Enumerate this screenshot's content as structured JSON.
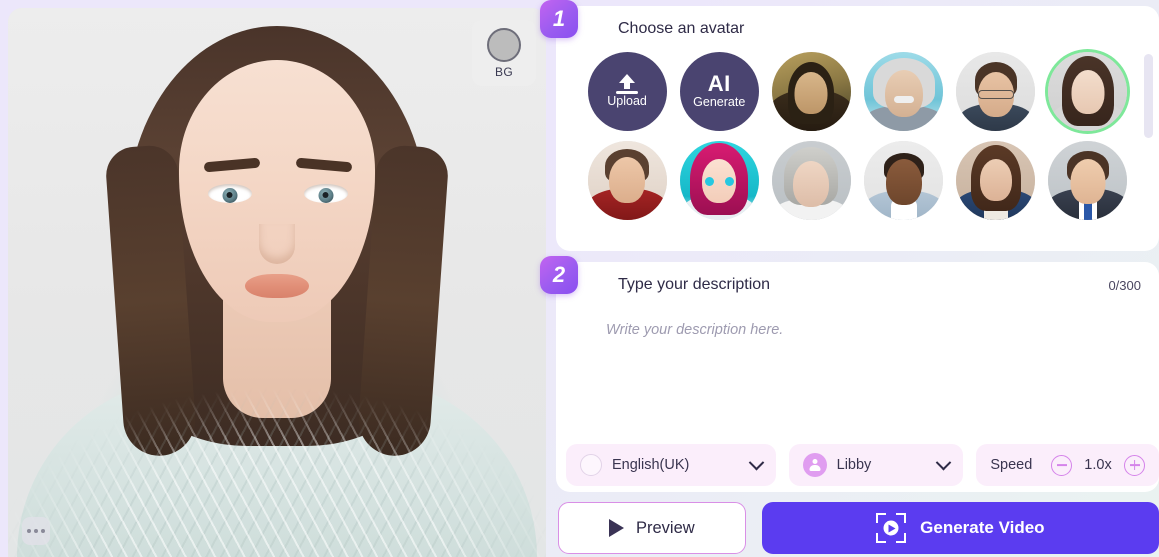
{
  "preview": {
    "bg_button": {
      "label": "BG",
      "icon": "background-circle-icon"
    },
    "menu_button": {
      "icon": "ellipsis-icon"
    }
  },
  "step1": {
    "badge": "1",
    "title": "Choose an avatar",
    "actions": [
      {
        "name": "upload",
        "glyph": "upload-arrow-icon",
        "label": "Upload"
      },
      {
        "name": "ai-generate",
        "glyph": "AI",
        "label": "Generate"
      }
    ],
    "avatars": [
      {
        "id": "mona-lisa",
        "selected": false
      },
      {
        "id": "einstein",
        "selected": false
      },
      {
        "id": "man-glasses",
        "selected": false
      },
      {
        "id": "woman-dark-hair",
        "selected": true
      },
      {
        "id": "man-red-jacket",
        "selected": false
      },
      {
        "id": "anime-pink-hair",
        "selected": false
      },
      {
        "id": "senior-woman",
        "selected": false
      },
      {
        "id": "man-blue-shirt",
        "selected": false
      },
      {
        "id": "woman-blazer",
        "selected": false
      },
      {
        "id": "man-suit-tie",
        "selected": false
      }
    ]
  },
  "step2": {
    "badge": "2",
    "title": "Type your description",
    "char_count": "0/300",
    "textarea_value": "",
    "textarea_placeholder": "Write your description here."
  },
  "controls": {
    "language": {
      "value": "English(UK)",
      "icon": "flag-placeholder-icon"
    },
    "voice": {
      "value": "Libby",
      "icon": "person-icon"
    },
    "speed": {
      "label": "Speed",
      "value": "1.0x",
      "decrease": "minus-icon",
      "increase": "plus-icon"
    }
  },
  "actions": {
    "preview": {
      "label": "Preview",
      "icon": "play-icon"
    },
    "generate": {
      "label": "Generate Video",
      "icon": "video-capture-icon"
    }
  },
  "colors": {
    "accent_purple": "#5b3cf0",
    "badge_gradient_start": "#c264f0",
    "badge_gradient_end": "#8a4ff0",
    "selected_ring": "#7ee89a",
    "pill_bg": "#fbeefb",
    "action_circle": "#4a4470"
  }
}
